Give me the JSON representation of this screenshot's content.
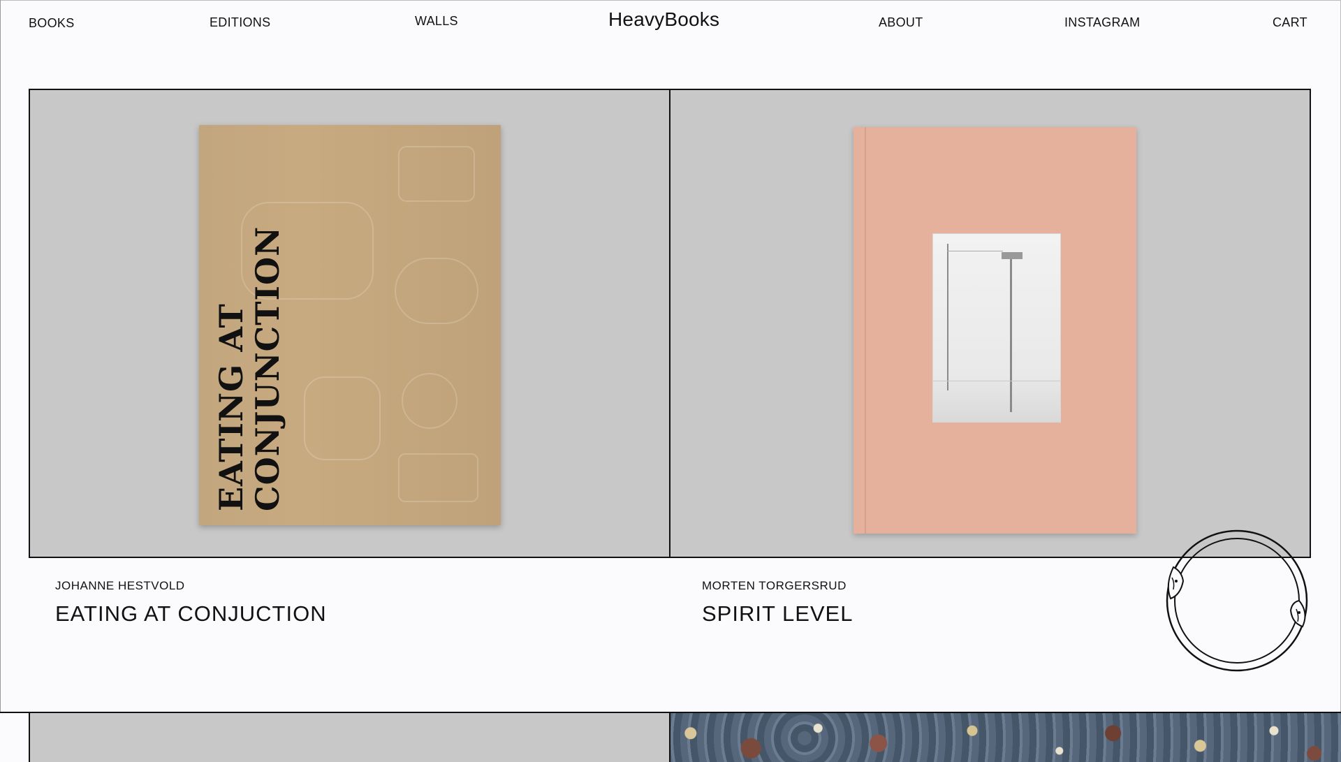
{
  "nav": {
    "books": "BOOKS",
    "editions": "EDITIONS",
    "walls": "WALLS",
    "brand": "HeavyBooks",
    "about": "ABOUT",
    "instagram": "INSTAGRAM",
    "cart": "CART"
  },
  "products": [
    {
      "author": "JOHANNE HESTVOLD",
      "title": "EATING AT CONJUCTION",
      "cover_text": "EATING AT\nCONJUNCTION",
      "cover_color": "#c6a87e"
    },
    {
      "author": "MORTEN TORGERSRUD",
      "title": "SPIRIT LEVEL",
      "cover_color": "#e6b19c"
    }
  ],
  "colors": {
    "background": "#fbfbfd",
    "tile_background": "#c8c8c9",
    "grid_line": "#111111"
  },
  "icons": {
    "ouroboros": "ouroboros-icon"
  }
}
